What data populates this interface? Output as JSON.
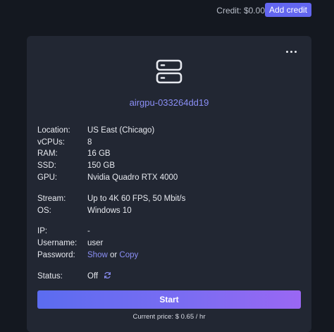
{
  "header": {
    "credit_text": "Credit: $0.00",
    "add_credit_label": "Add credit"
  },
  "card": {
    "menu_icon": "more-horizontal-icon",
    "server_icon": "server-icon",
    "machine_name": "airgpu-033264dd19",
    "specs": {
      "location_label": "Location:",
      "location_value": "US East (Chicago)",
      "vcpus_label": "vCPUs:",
      "vcpus_value": "8",
      "ram_label": "RAM:",
      "ram_value": "16 GB",
      "ssd_label": "SSD:",
      "ssd_value": "150 GB",
      "gpu_label": "GPU:",
      "gpu_value": "Nvidia Quadro RTX 4000"
    },
    "stream": {
      "stream_label": "Stream:",
      "stream_value": "Up to 4K 60 FPS, 50 Mbit/s",
      "os_label": "OS:",
      "os_value": "Windows 10"
    },
    "access": {
      "ip_label": "IP:",
      "ip_value": "-",
      "username_label": "Username:",
      "username_value": "user",
      "password_label": "Password:",
      "show_link": "Show",
      "or_text": "or",
      "copy_link": "Copy"
    },
    "status": {
      "status_label": "Status:",
      "status_value": "Off",
      "refresh_icon": "refresh-icon"
    },
    "start_label": "Start",
    "price_text": "Current price: $ 0.65 / hr"
  },
  "colors": {
    "accent": "#6366f1",
    "link": "#8b8ff6",
    "card_bg": "#222733",
    "page_bg": "#141820"
  }
}
